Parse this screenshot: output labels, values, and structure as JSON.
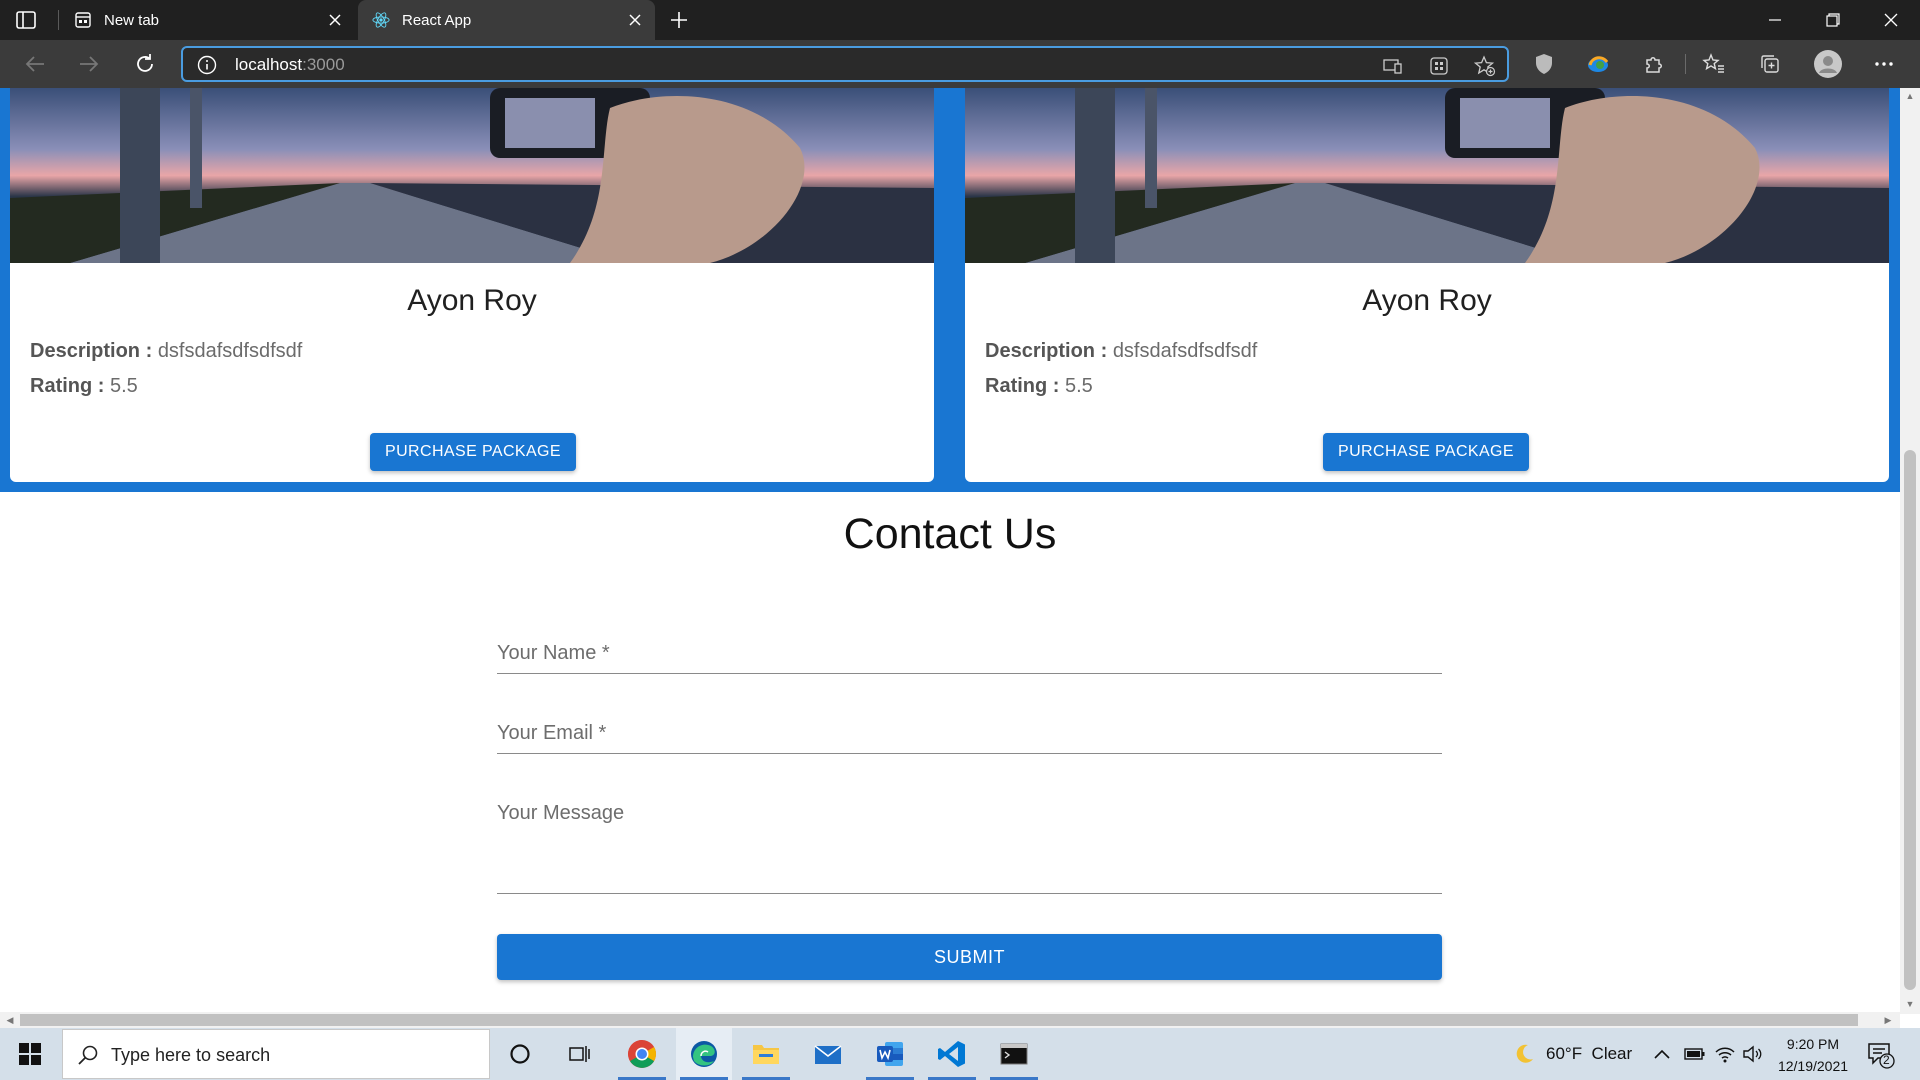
{
  "browser": {
    "tabs": [
      {
        "title": "New tab",
        "active": false
      },
      {
        "title": "React App",
        "active": true
      }
    ],
    "url_host": "localhost",
    "url_port": ":3000"
  },
  "cards": [
    {
      "name": "Ayon Roy",
      "description_label": "Description :",
      "description": "dsfsdafsdfsdfsdf",
      "rating_label": "Rating :",
      "rating": "5.5",
      "button_label": "PURCHASE PACKAGE"
    },
    {
      "name": "Ayon Roy",
      "description_label": "Description :",
      "description": "dsfsdafsdfsdfsdf",
      "rating_label": "Rating :",
      "rating": "5.5",
      "button_label": "PURCHASE PACKAGE"
    }
  ],
  "contact": {
    "title": "Contact Us",
    "name_placeholder": "Your Name *",
    "email_placeholder": "Your Email *",
    "message_placeholder": "Your Message",
    "submit_label": "SUBMIT"
  },
  "taskbar": {
    "search_placeholder": "Type here to search",
    "weather": "60°F  Clear",
    "time": "9:20 PM",
    "date": "12/19/2021",
    "notification_count": "2"
  },
  "colors": {
    "primary": "#1976d2",
    "chrome_dark": "#202020",
    "toolbar": "#3b3b3b"
  }
}
